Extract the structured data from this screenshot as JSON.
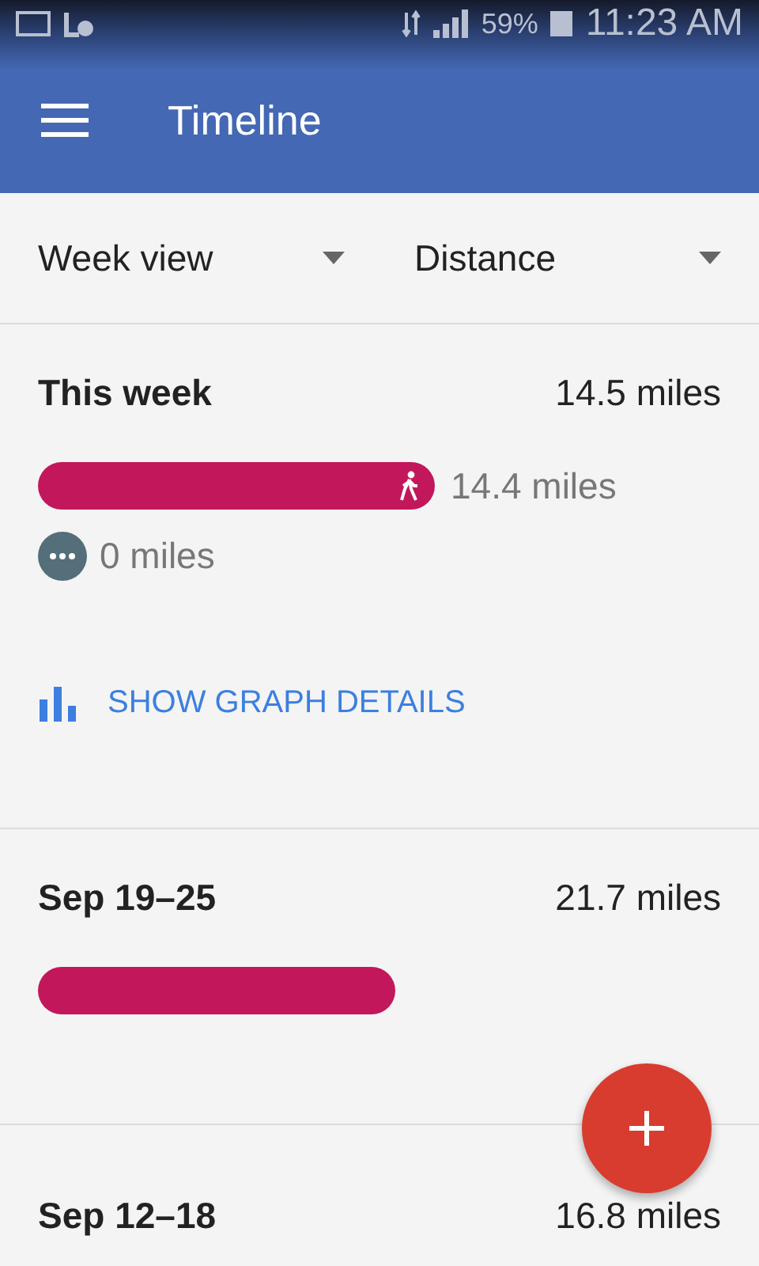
{
  "status_bar": {
    "battery": "59%",
    "time": "11:23 AM"
  },
  "app_bar": {
    "title": "Timeline"
  },
  "filters": [
    {
      "label": "Week view"
    },
    {
      "label": "Distance"
    }
  ],
  "weeks": [
    {
      "title": "This week",
      "total": "14.5 miles",
      "bars": [
        {
          "kind": "walking",
          "reading": "14.4 miles"
        }
      ],
      "other": {
        "reading": "0 miles"
      },
      "action": "SHOW GRAPH DETAILS"
    },
    {
      "title": "Sep 19–25",
      "total": "21.7 miles",
      "bars": [
        {
          "kind": "plain"
        }
      ]
    },
    {
      "title": "Sep 12–18",
      "total": "16.8 miles"
    }
  ]
}
